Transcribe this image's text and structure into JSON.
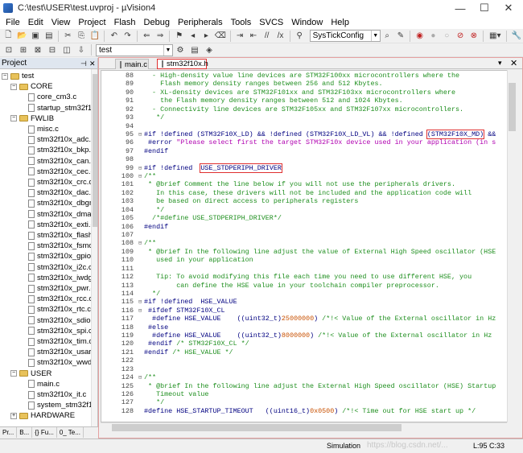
{
  "window": {
    "title": "C:\\test\\USER\\test.uvproj - µVision4"
  },
  "menu": [
    "File",
    "Edit",
    "View",
    "Project",
    "Flash",
    "Debug",
    "Peripherals",
    "Tools",
    "SVCS",
    "Window",
    "Help"
  ],
  "toolbar": {
    "function_combo": "SysTickConfig",
    "target_combo": "test"
  },
  "project_panel": {
    "title": "Project",
    "tree": [
      {
        "label": "test",
        "type": "root",
        "depth": 0
      },
      {
        "label": "CORE",
        "type": "folder",
        "depth": 1
      },
      {
        "label": "core_cm3.c",
        "type": "file",
        "depth": 2
      },
      {
        "label": "startup_stm32f1",
        "type": "file",
        "depth": 2
      },
      {
        "label": "FWLIB",
        "type": "folder",
        "depth": 1
      },
      {
        "label": "misc.c",
        "type": "file",
        "depth": 2
      },
      {
        "label": "stm32f10x_adc.c",
        "type": "file",
        "depth": 2
      },
      {
        "label": "stm32f10x_bkp.",
        "type": "file",
        "depth": 2
      },
      {
        "label": "stm32f10x_can.c",
        "type": "file",
        "depth": 2
      },
      {
        "label": "stm32f10x_cec.c",
        "type": "file",
        "depth": 2
      },
      {
        "label": "stm32f10x_crc.c",
        "type": "file",
        "depth": 2
      },
      {
        "label": "stm32f10x_dac.c",
        "type": "file",
        "depth": 2
      },
      {
        "label": "stm32f10x_dbgm",
        "type": "file",
        "depth": 2
      },
      {
        "label": "stm32f10x_dma.",
        "type": "file",
        "depth": 2
      },
      {
        "label": "stm32f10x_exti.c",
        "type": "file",
        "depth": 2
      },
      {
        "label": "stm32f10x_flash",
        "type": "file",
        "depth": 2
      },
      {
        "label": "stm32f10x_fsmc",
        "type": "file",
        "depth": 2
      },
      {
        "label": "stm32f10x_gpio",
        "type": "file",
        "depth": 2
      },
      {
        "label": "stm32f10x_i2c.c",
        "type": "file",
        "depth": 2
      },
      {
        "label": "stm32f10x_iwdg",
        "type": "file",
        "depth": 2
      },
      {
        "label": "stm32f10x_pwr.c",
        "type": "file",
        "depth": 2
      },
      {
        "label": "stm32f10x_rcc.c",
        "type": "file",
        "depth": 2
      },
      {
        "label": "stm32f10x_rtc.c",
        "type": "file",
        "depth": 2
      },
      {
        "label": "stm32f10x_sdio.",
        "type": "file",
        "depth": 2
      },
      {
        "label": "stm32f10x_spi.c",
        "type": "file",
        "depth": 2
      },
      {
        "label": "stm32f10x_tim.c",
        "type": "file",
        "depth": 2
      },
      {
        "label": "stm32f10x_usart",
        "type": "file",
        "depth": 2
      },
      {
        "label": "stm32f10x_wwdg",
        "type": "file",
        "depth": 2
      },
      {
        "label": "USER",
        "type": "folder",
        "depth": 1
      },
      {
        "label": "main.c",
        "type": "file",
        "depth": 2
      },
      {
        "label": "stm32f10x_it.c",
        "type": "file",
        "depth": 2
      },
      {
        "label": "system_stm32f1",
        "type": "file",
        "depth": 2
      },
      {
        "label": "HARDWARE",
        "type": "folder",
        "depth": 1
      }
    ],
    "bottom_tabs": [
      "Pr...",
      "B...",
      "{} Fu...",
      "0_ Te..."
    ]
  },
  "editor": {
    "tabs": [
      {
        "label": "main.c",
        "active": false
      },
      {
        "label": "stm32f10x.h",
        "active": true
      }
    ],
    "lines": [
      {
        "n": "88",
        "fold": "",
        "segs": [
          [
            "cm",
            "  - High-density value line devices are STM32F100xx microcontrollers where the"
          ]
        ]
      },
      {
        "n": "89",
        "fold": "",
        "segs": [
          [
            "cm",
            "    Flash memory density ranges between 256 and 512 Kbytes."
          ]
        ]
      },
      {
        "n": "90",
        "fold": "",
        "segs": [
          [
            "cm",
            "  - XL-density devices are STM32F101xx and STM32F103xx microcontrollers where"
          ]
        ]
      },
      {
        "n": "91",
        "fold": "",
        "segs": [
          [
            "cm",
            "    the Flash memory density ranges between 512 and 1024 Kbytes."
          ]
        ]
      },
      {
        "n": "92",
        "fold": "",
        "segs": [
          [
            "cm",
            "  - Connectivity line devices are STM32F105xx and STM32F107xx microcontrollers."
          ]
        ]
      },
      {
        "n": "93",
        "fold": "",
        "segs": [
          [
            "cm",
            "   */"
          ]
        ]
      },
      {
        "n": "94",
        "fold": "",
        "segs": []
      },
      {
        "n": "95",
        "fold": "⊟",
        "segs": [
          [
            "pp",
            "#if !defined (STM32F10X_LD) && !defined (STM32F10X_LD_VL) && !defined "
          ],
          [
            "pph",
            "(STM32F10X_MD)"
          ],
          [
            "pp",
            " &&"
          ]
        ]
      },
      {
        "n": "96",
        "fold": "",
        "segs": [
          [
            "pp",
            " #error "
          ],
          [
            "st",
            "\"Please select first the target STM32F10x device used in your application (in s"
          ]
        ]
      },
      {
        "n": "97",
        "fold": "",
        "segs": [
          [
            "pp",
            "#endif"
          ]
        ]
      },
      {
        "n": "98",
        "fold": "",
        "segs": []
      },
      {
        "n": "99",
        "fold": "⊟",
        "segs": [
          [
            "pp",
            "#if !defined  "
          ],
          [
            "pph",
            "USE_STDPERIPH_DRIVER"
          ]
        ]
      },
      {
        "n": "100",
        "fold": "⊟",
        "segs": [
          [
            "cm",
            "/**"
          ]
        ]
      },
      {
        "n": "101",
        "fold": "",
        "segs": [
          [
            "cm",
            " * @brief Comment the line below if you will not use the peripherals drivers."
          ]
        ]
      },
      {
        "n": "102",
        "fold": "",
        "segs": [
          [
            "cm",
            "   In this case, these drivers will not be included and the application code will"
          ]
        ]
      },
      {
        "n": "103",
        "fold": "",
        "segs": [
          [
            "cm",
            "   be based on direct access to peripherals registers"
          ]
        ]
      },
      {
        "n": "104",
        "fold": "",
        "segs": [
          [
            "cm",
            "   */"
          ]
        ]
      },
      {
        "n": "105",
        "fold": "",
        "segs": [
          [
            "cm",
            "  /*#define USE_STDPERIPH_DRIVER*/"
          ]
        ]
      },
      {
        "n": "106",
        "fold": "",
        "segs": [
          [
            "pp",
            "#endif"
          ]
        ]
      },
      {
        "n": "107",
        "fold": "",
        "segs": []
      },
      {
        "n": "108",
        "fold": "⊟",
        "segs": [
          [
            "cm",
            "/**"
          ]
        ]
      },
      {
        "n": "109",
        "fold": "",
        "segs": [
          [
            "cm",
            " * @brief In the following line adjust the value of External High Speed oscillator (HSE"
          ]
        ]
      },
      {
        "n": "110",
        "fold": "",
        "segs": [
          [
            "cm",
            "   used in your application"
          ]
        ]
      },
      {
        "n": "111",
        "fold": "",
        "segs": []
      },
      {
        "n": "112",
        "fold": "",
        "segs": [
          [
            "cm",
            "   Tip: To avoid modifying this file each time you need to use different HSE, you"
          ]
        ]
      },
      {
        "n": "113",
        "fold": "",
        "segs": [
          [
            "cm",
            "        can define the HSE value in your toolchain compiler preprocessor."
          ]
        ]
      },
      {
        "n": "114",
        "fold": "",
        "segs": [
          [
            "cm",
            "  */"
          ]
        ]
      },
      {
        "n": "115",
        "fold": "⊟",
        "segs": [
          [
            "pp",
            "#if !defined  HSE_VALUE"
          ]
        ]
      },
      {
        "n": "116",
        "fold": "⊟",
        "segs": [
          [
            "pp",
            " #ifdef STM32F10X_CL"
          ]
        ]
      },
      {
        "n": "117",
        "fold": "",
        "segs": [
          [
            "pp",
            "  #define HSE_VALUE    ((uint32_t)"
          ],
          [
            "nm",
            "25000000"
          ],
          [
            "pp",
            ") "
          ],
          [
            "cm",
            "/*!< Value of the External oscillator in Hz"
          ]
        ]
      },
      {
        "n": "118",
        "fold": "",
        "segs": [
          [
            "pp",
            " #else"
          ]
        ]
      },
      {
        "n": "119",
        "fold": "",
        "segs": [
          [
            "pp",
            "  #define HSE_VALUE    ((uint32_t)"
          ],
          [
            "nm",
            "8000000"
          ],
          [
            "pp",
            ") "
          ],
          [
            "cm",
            "/*!< Value of the External oscillator in Hz"
          ]
        ]
      },
      {
        "n": "120",
        "fold": "",
        "segs": [
          [
            "pp",
            " #endif "
          ],
          [
            "cm",
            "/* STM32F10X_CL */"
          ]
        ]
      },
      {
        "n": "121",
        "fold": "",
        "segs": [
          [
            "pp",
            "#endif "
          ],
          [
            "cm",
            "/* HSE_VALUE */"
          ]
        ]
      },
      {
        "n": "122",
        "fold": "",
        "segs": []
      },
      {
        "n": "123",
        "fold": "",
        "segs": []
      },
      {
        "n": "124",
        "fold": "⊟",
        "segs": [
          [
            "cm",
            "/**"
          ]
        ]
      },
      {
        "n": "125",
        "fold": "",
        "segs": [
          [
            "cm",
            " * @brief In the following line adjust the External High Speed oscillator (HSE) Startup"
          ]
        ]
      },
      {
        "n": "126",
        "fold": "",
        "segs": [
          [
            "cm",
            "   Timeout value"
          ]
        ]
      },
      {
        "n": "127",
        "fold": "",
        "segs": [
          [
            "cm",
            "   */"
          ]
        ]
      },
      {
        "n": "128",
        "fold": "",
        "segs": [
          [
            "pp",
            "#define HSE_STARTUP_TIMEOUT   ((uint16_t)"
          ],
          [
            "nm",
            "0x0500"
          ],
          [
            "pp",
            ") "
          ],
          [
            "cm",
            "/*!< Time out for HSE start up */"
          ]
        ]
      }
    ]
  },
  "statusbar": {
    "mode": "Simulation",
    "position": "L:95 C:33",
    "watermark": "https://blog.csdn.net/..."
  },
  "colors": {
    "comment": "#1f8f1f",
    "preprocessor": "#000080",
    "string": "#b000b0",
    "number": "#c85000",
    "highlight_box": "#e03030"
  }
}
